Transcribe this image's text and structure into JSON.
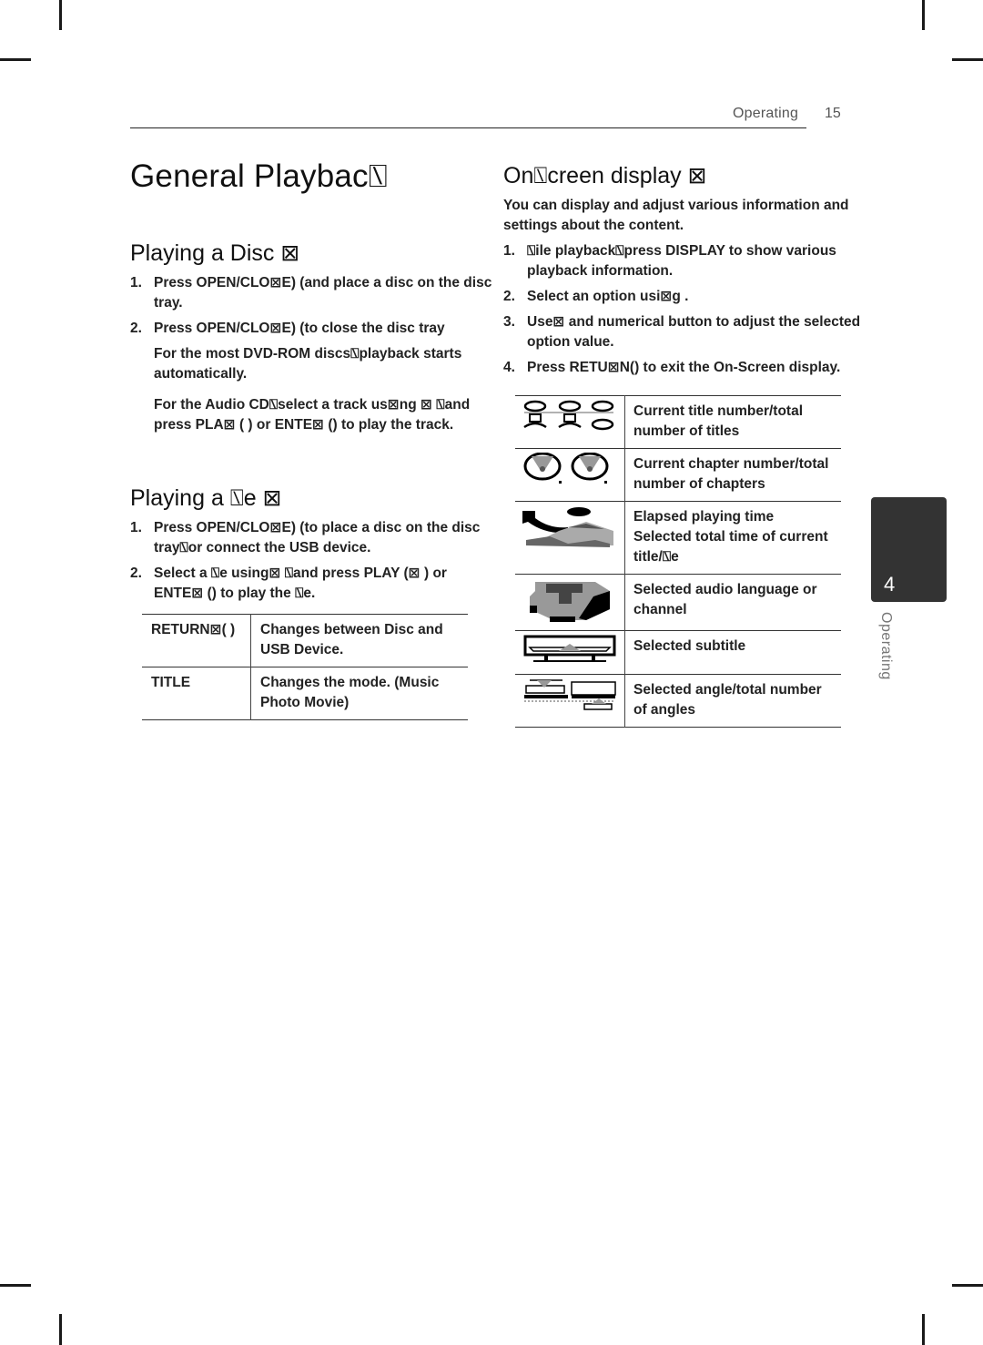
{
  "header": {
    "running_head": "Operating",
    "page_number": "15"
  },
  "page_title": "General Playbac⍂",
  "playing_disc": {
    "heading": "Playing a Disc ⊠",
    "steps": [
      {
        "num": "1.",
        "text": "Press OPEN/CLO⊠E) (and place a disc on the disc tray."
      },
      {
        "num": "2.",
        "text": "Press OPEN/CLO⊠E) (to close the disc tray",
        "notes": [
          "For the most DVD-ROM discs⍂playback starts automatically.",
          "For the Audio CD⍂select a track us⊠ng ⊠      ⍂and press PLA⊠ ( ) or ENTE⊠ () to play the track."
        ]
      }
    ]
  },
  "playing_file": {
    "heading": "Playing a ⍂e    ⊠",
    "steps": [
      {
        "num": "1.",
        "text": "Press OPEN/CLO⊠E) (to place a disc on the disc tray⍂or connect the USB device."
      },
      {
        "num": "2.",
        "text": "Select a ⍂e using⊠                  ⍂and press PLAY (⊠   ) or ENTE⊠ () to play the ⍂e."
      }
    ],
    "table": [
      {
        "key": "RETURN⊠( )",
        "value": "Changes between Disc and USB Device."
      },
      {
        "key": "TITLE",
        "value": "Changes the mode. (Music Photo    Movie)"
      }
    ]
  },
  "on_screen": {
    "heading": "On⍂creen display   ⊠",
    "intro": "You can display and adjust various information and settings about the content.",
    "steps": [
      {
        "num": "1.",
        "text": "⍂ile playback⍂press DISPLAY to show various playback information."
      },
      {
        "num": "2.",
        "text": "Select an option usi⊠g      ."
      },
      {
        "num": "3.",
        "text": "Use⊠        and numerical button to adjust the selected option value."
      },
      {
        "num": "4.",
        "text": "Press RETU⊠N() to exit the On-Screen display."
      }
    ],
    "table": [
      {
        "icon": "title-icon",
        "value": "Current title number/total number of titles"
      },
      {
        "icon": "chapter-icon",
        "value": "Current chapter number/total number of chapters"
      },
      {
        "icon": "time-icon",
        "value": "Elapsed playing time\nSelected total time of current title/⍂e"
      },
      {
        "icon": "audio-icon",
        "value": "Selected audio language or channel"
      },
      {
        "icon": "subtitle-icon",
        "value": "Selected subtitle"
      },
      {
        "icon": "angle-icon",
        "value": "Selected angle/total number of angles"
      }
    ]
  },
  "chapter_tab": {
    "number": "4",
    "label": "Operating"
  }
}
